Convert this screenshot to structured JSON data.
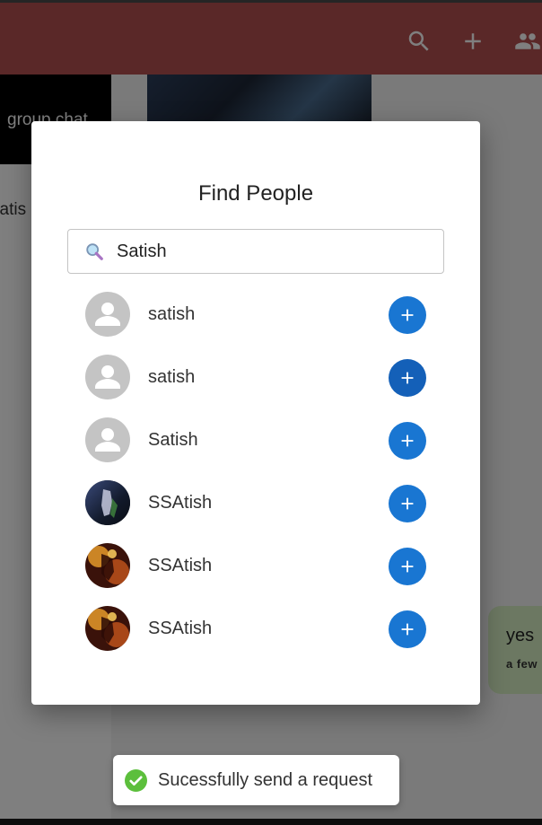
{
  "sidebar": {
    "group_label": "group chat",
    "contact_preview": "satis"
  },
  "chat": {
    "bubble_message": "yes",
    "bubble_time": "a few"
  },
  "modal": {
    "title": "Find People",
    "search": {
      "value": "Satish",
      "icon": "search-icon"
    },
    "people": [
      {
        "name": "satish",
        "avatar": "default"
      },
      {
        "name": "satish",
        "avatar": "default"
      },
      {
        "name": "Satish",
        "avatar": "default"
      },
      {
        "name": "SSAtish",
        "avatar": "photo-dark"
      },
      {
        "name": "SSAtish",
        "avatar": "photo-fire"
      },
      {
        "name": "SSAtish",
        "avatar": "photo-fire"
      }
    ]
  },
  "snackbar": {
    "message": "Sucessfully send a request",
    "status_color": "#5cbf3c"
  },
  "colors": {
    "appbar": "#b55050",
    "accent": "#1976d2"
  }
}
